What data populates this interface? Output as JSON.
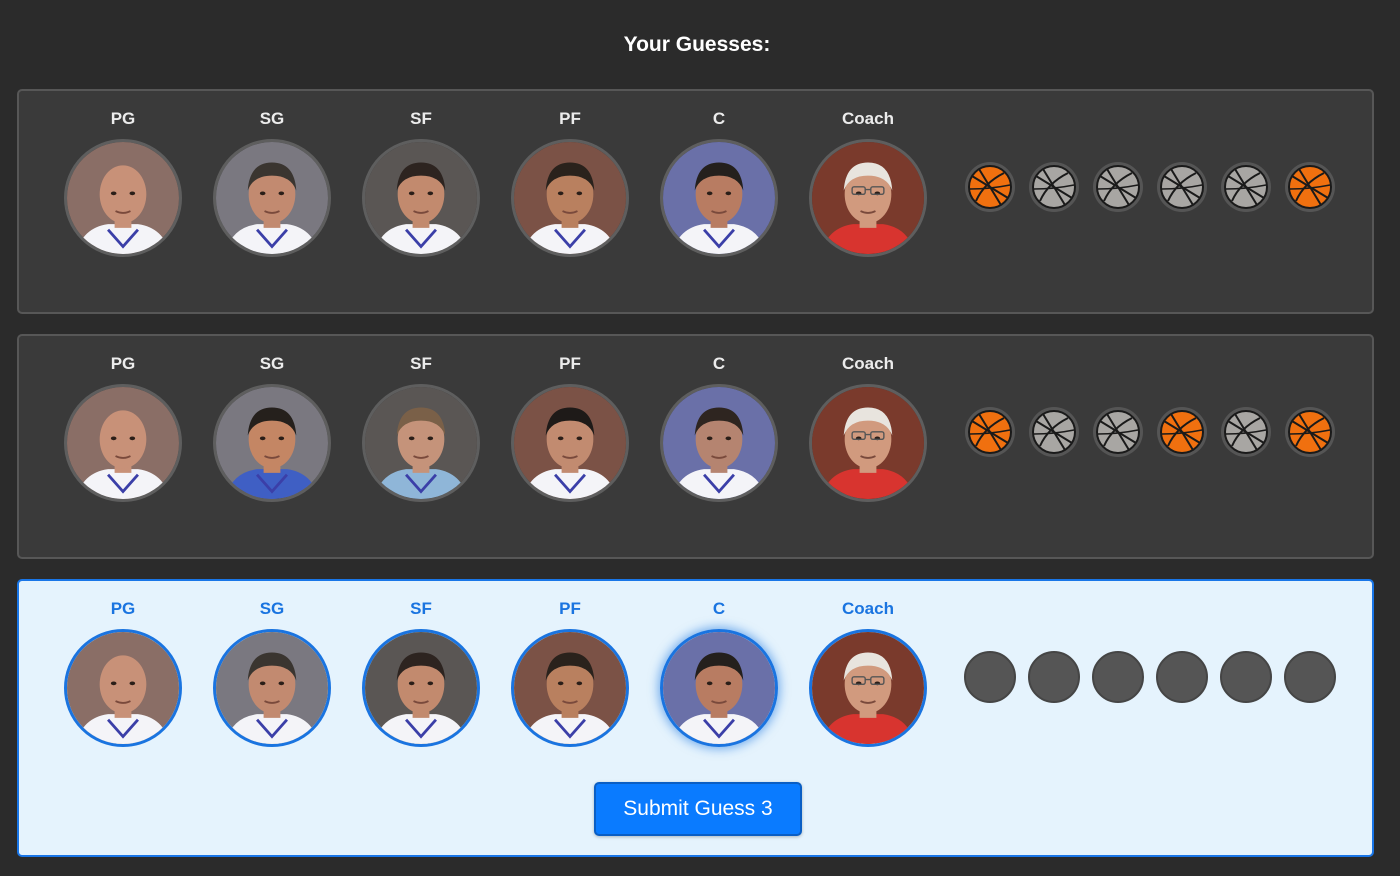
{
  "title": "Your Guesses:",
  "positions": [
    "PG",
    "SG",
    "SF",
    "PF",
    "C",
    "Coach"
  ],
  "guesses": [
    {
      "state": "submitted",
      "players": [
        {
          "skin": "#c89178",
          "hair": "bald",
          "jersey": "white"
        },
        {
          "skin": "#c28a70",
          "hair": "#3a3530",
          "jersey": "white"
        },
        {
          "skin": "#c28a6e",
          "hair": "#2d2420",
          "jersey": "white"
        },
        {
          "skin": "#b9805f",
          "hair": "#2a221c",
          "jersey": "white"
        },
        {
          "skin": "#b87c62",
          "hair": "#24201d",
          "jersey": "white"
        },
        {
          "skin": "#d19a7e",
          "hair": "#e8e4de",
          "jersey": "red"
        }
      ],
      "results": [
        "correct",
        "wrong",
        "wrong",
        "wrong",
        "wrong",
        "correct"
      ]
    },
    {
      "state": "submitted",
      "players": [
        {
          "skin": "#c89178",
          "hair": "bald",
          "jersey": "white"
        },
        {
          "skin": "#c48664",
          "hair": "#25201c",
          "jersey": "blue"
        },
        {
          "skin": "#c5937a",
          "hair": "#7a6048",
          "jersey": "lightblue"
        },
        {
          "skin": "#c28b70",
          "hair": "#1e1a18",
          "jersey": "white"
        },
        {
          "skin": "#b58470",
          "hair": "#2e2520",
          "jersey": "white"
        },
        {
          "skin": "#d19a7e",
          "hair": "#e8e4de",
          "jersey": "red"
        }
      ],
      "results": [
        "correct",
        "wrong",
        "wrong",
        "correct",
        "wrong",
        "correct"
      ]
    },
    {
      "state": "current",
      "players": [
        {
          "skin": "#c89178",
          "hair": "bald",
          "jersey": "white"
        },
        {
          "skin": "#c28a70",
          "hair": "#3a3530",
          "jersey": "white"
        },
        {
          "skin": "#c28a6e",
          "hair": "#2d2420",
          "jersey": "white"
        },
        {
          "skin": "#b9805f",
          "hair": "#2a221c",
          "jersey": "white"
        },
        {
          "skin": "#b87c62",
          "hair": "#24201d",
          "jersey": "white"
        },
        {
          "skin": "#d19a7e",
          "hair": "#e8e4de",
          "jersey": "red"
        }
      ],
      "results": [
        "empty",
        "empty",
        "empty",
        "empty",
        "empty",
        "empty"
      ],
      "submit_label": "Submit Guess 3"
    }
  ],
  "colors": {
    "page_bg": "#2b2b2b",
    "row_bg": "#3a3a3a",
    "current_row_bg": "#e5f3fd",
    "accent": "#1a74e0",
    "ball_correct": "#f0700f",
    "ball_wrong": "#a8a6a3",
    "ball_empty": "#555555"
  }
}
